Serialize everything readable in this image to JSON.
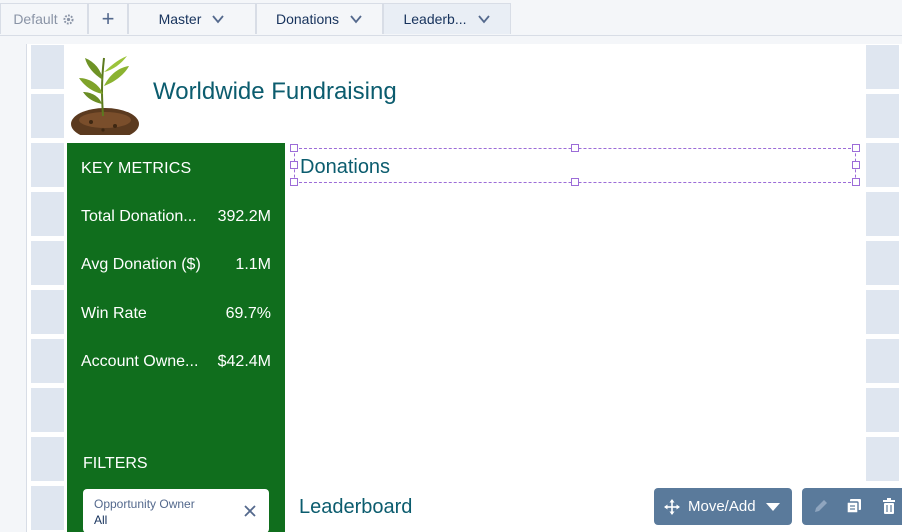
{
  "tabs": {
    "default_label": "Default",
    "add_label": "+",
    "master_label": "Master",
    "donations_label": "Donations",
    "leaderboard_label": "Leaderb..."
  },
  "header": {
    "title": "Worldwide Fundraising"
  },
  "sidebar": {
    "metrics_title": "KEY METRICS",
    "metrics": [
      {
        "label": "Total Donation...",
        "value": "392.2M"
      },
      {
        "label": "Avg Donation ($)",
        "value": "1.1M"
      },
      {
        "label": "Win Rate",
        "value": "69.7%"
      },
      {
        "label": "Account Owne...",
        "value": "$42.4M"
      }
    ],
    "filters_title": "FILTERS",
    "filter": {
      "label": "Opportunity Owner",
      "value": "All"
    }
  },
  "widgets": {
    "donations_title": "Donations",
    "leaderboard_title": "Leaderboard"
  },
  "toolbar": {
    "move_add_label": "Move/Add"
  },
  "colors": {
    "sidebar_green": "#106e1d",
    "title_teal": "#0b5c6e",
    "toolbar_slate": "#5a7a9b",
    "selection_purple": "#9c6cd8"
  }
}
